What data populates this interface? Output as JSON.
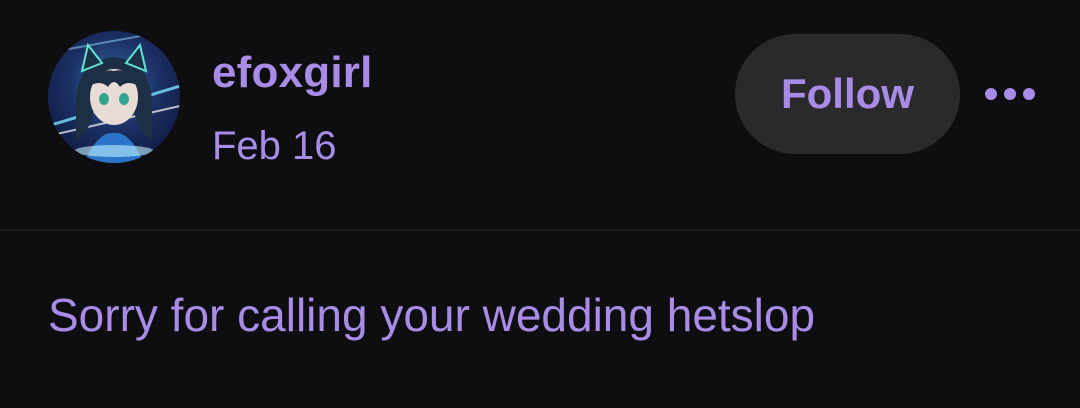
{
  "post": {
    "author": {
      "username": "efoxgirl",
      "date": "Feb 16",
      "avatar_icon": "anime-girl-avatar"
    },
    "follow_label": "Follow",
    "more_icon": "more-horizontal-icon",
    "body_text": "Sorry for calling your wedding hetslop"
  },
  "colors": {
    "background": "#0e0e10",
    "accent": "#a98be8",
    "button_bg": "#2a2a2c",
    "divider": "#1c1c1f"
  }
}
